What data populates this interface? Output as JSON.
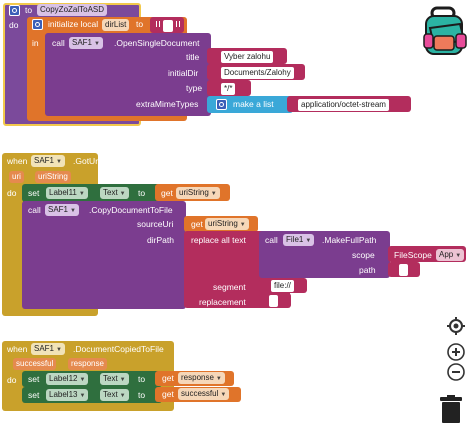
{
  "proc": {
    "kw_to": "to",
    "name": "CopyZoZalToASD",
    "kw_do": "do",
    "kw_init": "initialize local",
    "var": "dirList",
    "kw_to2": "to",
    "kw_in": "in",
    "kw_call": "call",
    "comp": "SAF1",
    "method": ".OpenSingleDocument",
    "p_title": "title",
    "v_title": "Vyber zalohu",
    "p_initdir": "initialDir",
    "v_initdir": "Documents/Zalohy",
    "p_type": "type",
    "v_type": "*/*",
    "p_mime": "extraMimeTypes",
    "makelist": "make a list",
    "v_mime": "application/octet-stream"
  },
  "gotUri": {
    "kw_when": "when",
    "comp": "SAF1",
    "event": ".GotUri",
    "p1": "uri",
    "p2": "uriString",
    "kw_do": "do",
    "kw_set": "set",
    "label": "Label11",
    "prop": "Text",
    "kw_to": "to",
    "kw_get": "get",
    "getvar": "uriString",
    "kw_call": "call",
    "comp2": "SAF1",
    "method": ".CopyDocumentToFile",
    "p_src": "sourceUri",
    "kw_get2": "get",
    "v_src": "uriString",
    "p_dir": "dirPath",
    "replace": "replace all text",
    "kw_call2": "call",
    "file": "File1",
    "mfp": ".MakeFullPath",
    "p_scope": "scope",
    "scope_comp": "FileScope",
    "scope_val": "App",
    "p_path": "path",
    "p_segment": "segment",
    "v_segment": "file://",
    "p_repl": "replacement"
  },
  "copied": {
    "kw_when": "when",
    "comp": "SAF1",
    "event": ".DocumentCopiedToFile",
    "p1": "successful",
    "p2": "response",
    "kw_do": "do",
    "set1_kw": "set",
    "set1_label": "Label12",
    "set1_prop": "Text",
    "set1_to": "to",
    "set1_get": "get",
    "set1_var": "response",
    "set2_kw": "set",
    "set2_label": "Label13",
    "set2_prop": "Text",
    "set2_to": "to",
    "set2_get": "get",
    "set2_var": "successful"
  },
  "icons": [
    "backpack-icon",
    "target-icon",
    "zoom-in-icon",
    "zoom-out-icon",
    "trash-icon"
  ],
  "colors": {
    "procedure": "#7b4a9b",
    "event": "#c9a12b",
    "variable": "#e0742a",
    "component": "#6a3d8f",
    "setter": "#2f6f3e",
    "text": "#b32d5d",
    "list": "#3aa8d8",
    "selected": "#f2c94c"
  }
}
